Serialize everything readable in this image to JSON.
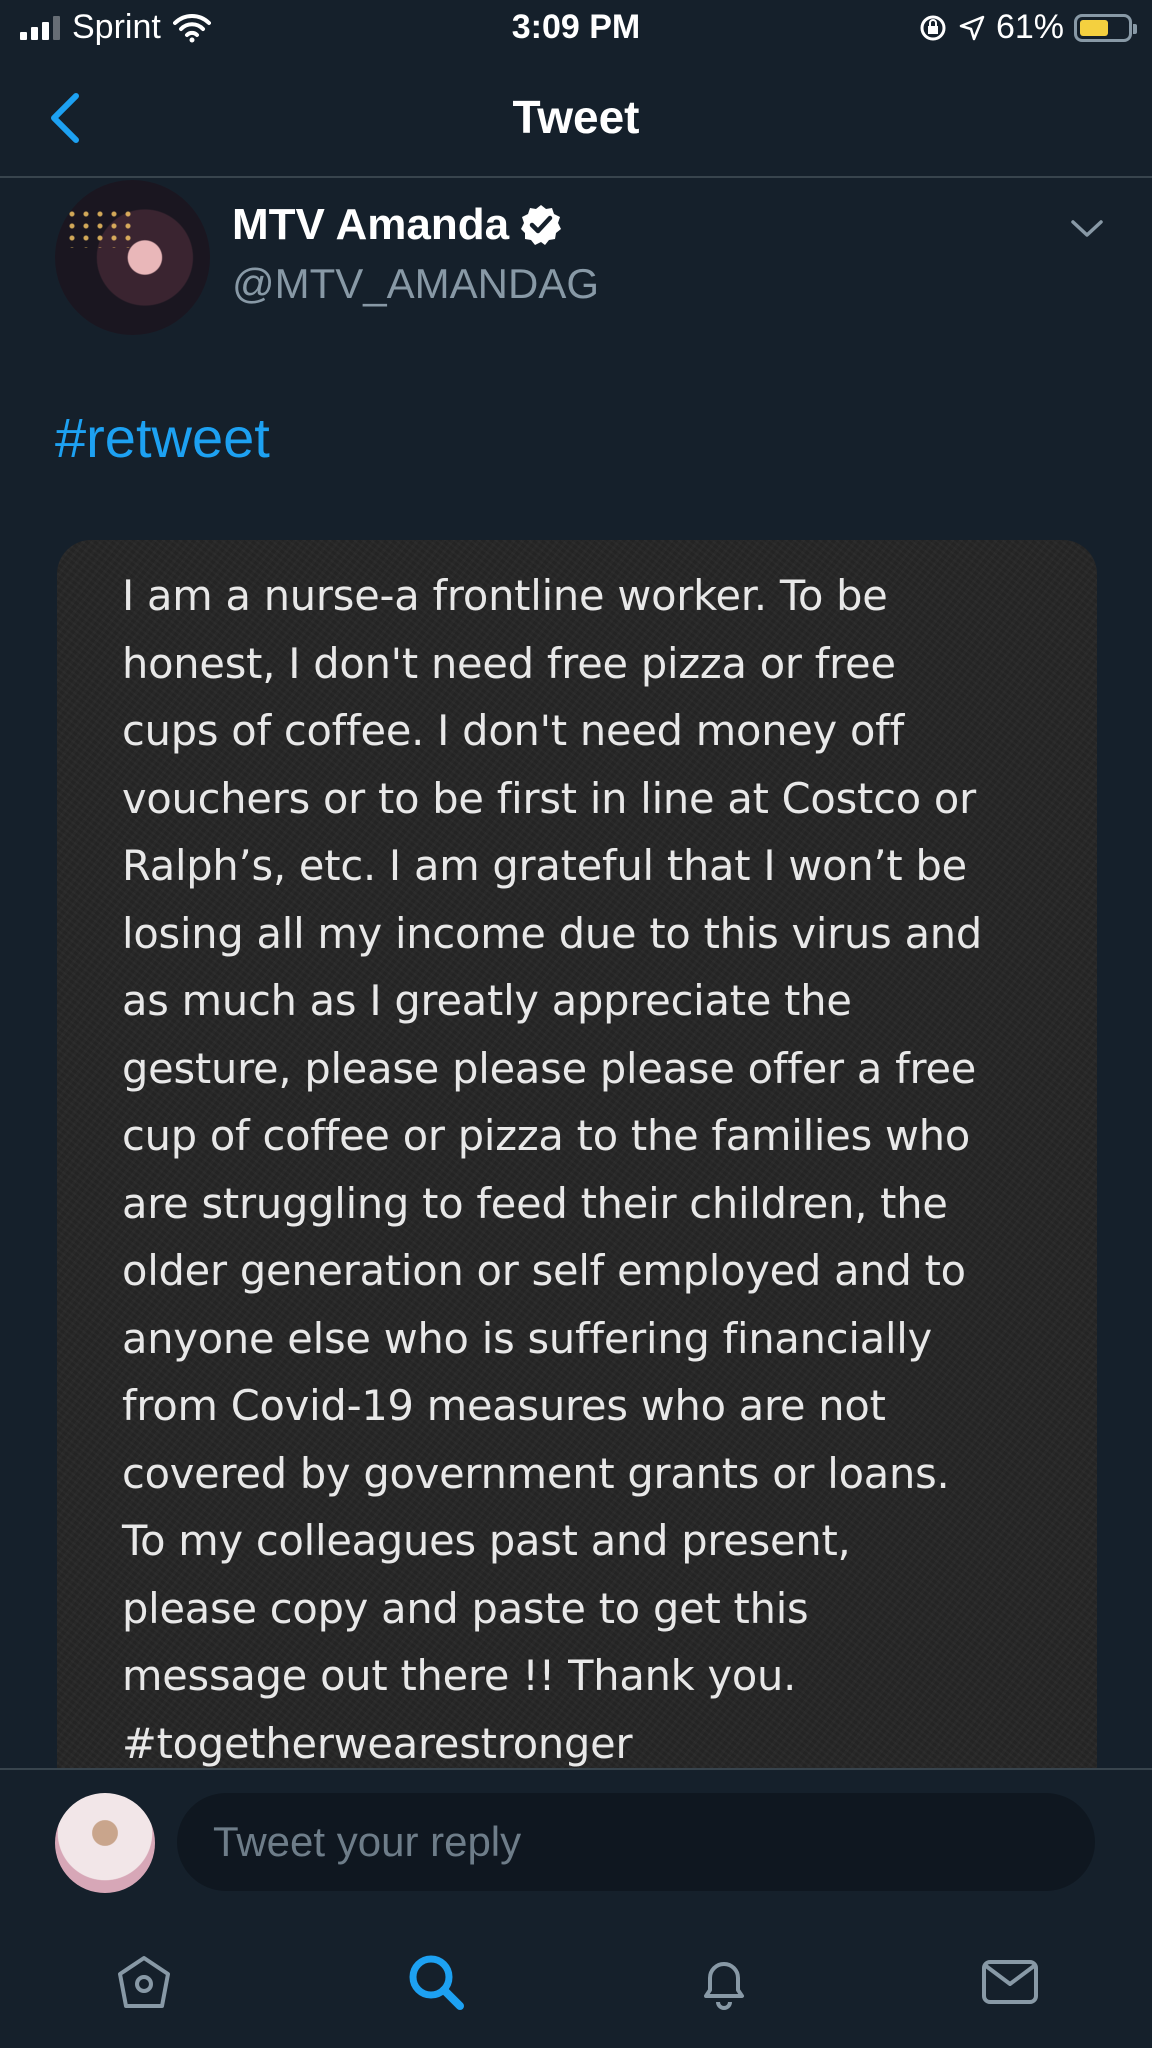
{
  "status_bar": {
    "carrier": "Sprint",
    "time": "3:09 PM",
    "battery_percent": "61%",
    "battery_level": 0.61,
    "battery_color": "#f4d03f"
  },
  "nav": {
    "title": "Tweet",
    "back_icon": "chevron-left-icon"
  },
  "tweet": {
    "author": {
      "display_name": "MTV Amanda",
      "handle": "@MTV_AMANDAG",
      "verified": true
    },
    "hashtag": "#retweet",
    "image_text": "I am a nurse-a frontline worker. To be\nhonest, I don't need free pizza or free\ncups of coffee. I don't need money off\nvouchers or to be first in line at Costco or\nRalph’s, etc. I am grateful that I won’t be\nlosing all my income due to this virus and\nas much as I greatly appreciate the\ngesture, please please please offer a free\ncup of coffee or pizza to the families who\nare struggling to feed their children, the\nolder generation or self employed and to\nanyone else who is suffering financially\nfrom Covid-19 measures who are not\ncovered by government grants or loans.\nTo my colleagues past and present,\nplease copy and paste to get this\nmessage out there !! Thank you.\n#togetherwearestronger"
  },
  "reply": {
    "placeholder": "Tweet your reply"
  },
  "tab_bar": {
    "items": [
      "home-icon",
      "search-icon",
      "notifications-icon",
      "messages-icon"
    ],
    "active": "search-icon"
  },
  "colors": {
    "background": "#15202b",
    "accent": "#1da1f2",
    "secondary_text": "#8899a6",
    "divider": "#38444d"
  }
}
